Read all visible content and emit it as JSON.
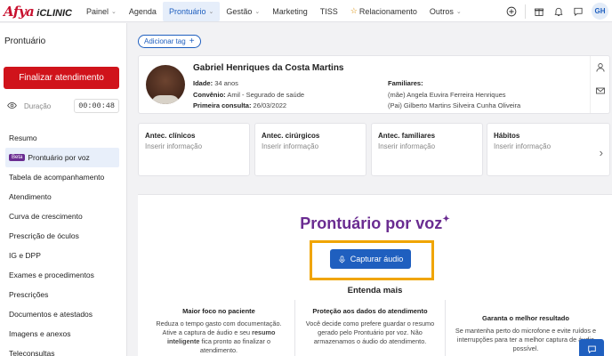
{
  "logo": {
    "brand": "Afya",
    "product": "iCLINIC"
  },
  "nav": {
    "items": [
      {
        "label": "Painel",
        "has_chevron": true
      },
      {
        "label": "Agenda",
        "has_chevron": false
      },
      {
        "label": "Prontuário",
        "has_chevron": true,
        "active": true
      },
      {
        "label": "Gestão",
        "has_chevron": true
      },
      {
        "label": "Marketing",
        "has_chevron": false
      },
      {
        "label": "TISS",
        "has_chevron": false
      },
      {
        "label": "Relacionamento",
        "has_chevron": false,
        "icon": "star-icon"
      },
      {
        "label": "Outros",
        "has_chevron": true
      }
    ],
    "avatar_initials": "GH"
  },
  "sidebar": {
    "title": "Prontuário",
    "finalize_label": "Finalizar atendimento",
    "duration_label": "Duração",
    "duration_value": "00:00:48",
    "beta_badge": "Beta",
    "items": [
      "Resumo",
      "Prontuário por voz",
      "Tabela de acompanhamento",
      "Atendimento",
      "Curva de crescimento",
      "Prescrição de óculos",
      "IG e DPP",
      "Exames e procedimentos",
      "Prescrições",
      "Documentos e atestados",
      "Imagens e anexos",
      "Teleconsultas"
    ]
  },
  "main": {
    "add_tag_label": "Adicionar tag",
    "patient": {
      "name": "Gabriel Henriques da Costa Martins",
      "age_label": "Idade:",
      "age": "34 anos",
      "insurance_label": "Convênio:",
      "insurance": "Amil - Segurado de saúde",
      "first_visit_label": "Primeira consulta:",
      "first_visit": "26/03/2022",
      "family_label": "Familiares:",
      "family": [
        "(mãe) Angela Euvira Ferreira Henriques",
        "(Pai) Gilberto Martins Silveira Cunha Oliveira"
      ]
    },
    "antecedents": [
      {
        "title": "Antec. clínicos",
        "placeholder": "Inserir informação"
      },
      {
        "title": "Antec. cirúrgicos",
        "placeholder": "Inserir informação"
      },
      {
        "title": "Antec. familiares",
        "placeholder": "Inserir informação"
      },
      {
        "title": "Hábitos",
        "placeholder": "Inserir informação"
      }
    ],
    "voice": {
      "title": "Prontuário por voz",
      "capture_label": "Capturar áudio",
      "learn_more": "Entenda mais",
      "columns": [
        {
          "heading": "Maior foco no paciente",
          "text_before": "Reduza o tempo gasto com documentação. Ative a captura de áudio e seu ",
          "text_bold": "resumo inteligente",
          "text_after": " fica pronto ao finalizar o atendimento."
        },
        {
          "heading": "Proteção aos dados do atendimento",
          "text": "Você decide como prefere guardar o resumo gerado pelo Prontuário por voz. Não armazenamos o áudio do atendimento."
        },
        {
          "heading": "Garanta o melhor resultado",
          "text": "Se mantenha perto do microfone e evite ruídos e interrupções para ter a melhor captura de áudio possível."
        }
      ]
    }
  },
  "colors": {
    "brand_red": "#d0131b",
    "primary_blue": "#1f5fbf",
    "purple": "#6a2c91",
    "highlight_orange": "#f0a500"
  }
}
